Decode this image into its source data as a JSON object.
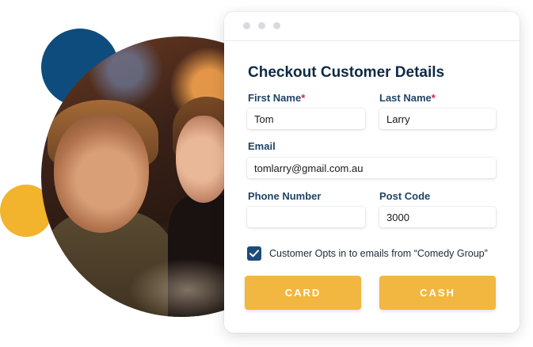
{
  "form": {
    "title": "Checkout Customer Details",
    "first_name": {
      "label": "First Name",
      "required_mark": "*",
      "value": "Tom"
    },
    "last_name": {
      "label": "Last Name",
      "required_mark": "*",
      "value": "Larry"
    },
    "email": {
      "label": "Email",
      "value": "tomlarry@gmail.com.au"
    },
    "phone": {
      "label": "Phone Number",
      "value": ""
    },
    "post_code": {
      "label": "Post Code",
      "value": "3000"
    },
    "opt_in": {
      "label": "Customer Opts in to emails from “Comedy Group”",
      "checked": true
    },
    "buttons": {
      "card": "CARD",
      "cash": "CASH"
    }
  },
  "colors": {
    "accent": "#f2b740",
    "navy": "#0f4c7e",
    "yellow_circle": "#f2b42c",
    "required": "#d0263b",
    "checkbox": "#1c4b78"
  },
  "icons": {
    "window_dots": [
      "window-dot-icon",
      "window-dot-icon",
      "window-dot-icon"
    ],
    "checkmark": "checkmark-icon"
  }
}
